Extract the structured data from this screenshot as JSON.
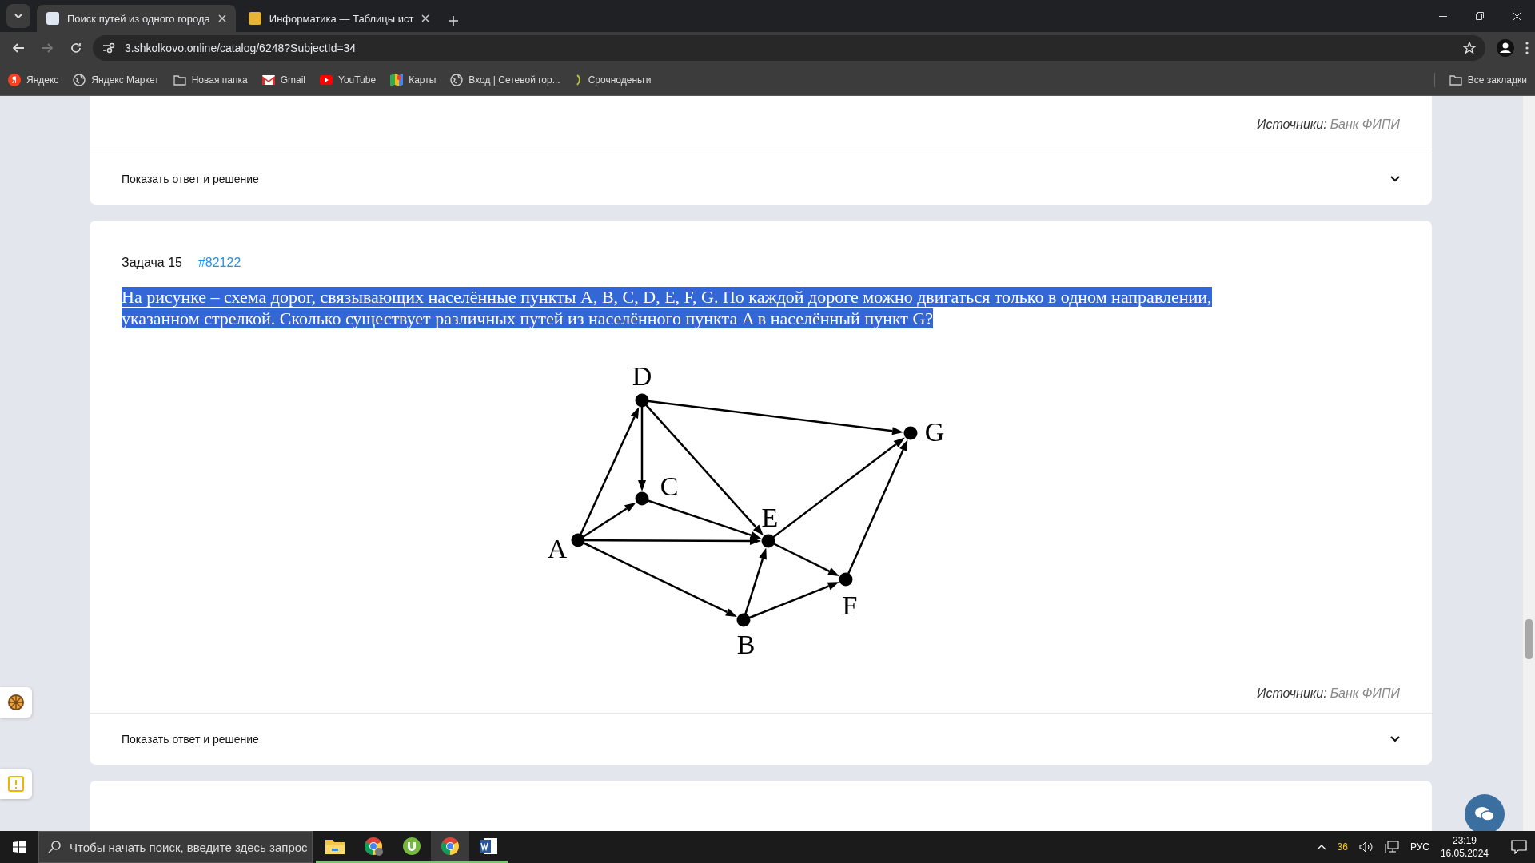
{
  "browser": {
    "tabs": [
      {
        "title": "Поиск путей из одного города",
        "selected": true
      },
      {
        "title": "Информатика — Таблицы ист",
        "selected": false
      }
    ],
    "address": "3.shkolkovo.online/catalog/6248?SubjectId=34",
    "bookmarks": [
      {
        "label": "Яндекс",
        "kind": "yandex"
      },
      {
        "label": "Яндекс Маркет",
        "kind": "globe"
      },
      {
        "label": "Новая папка",
        "kind": "folder"
      },
      {
        "label": "Gmail",
        "kind": "mail"
      },
      {
        "label": "YouTube",
        "kind": "video"
      },
      {
        "label": "Карты",
        "kind": "map"
      },
      {
        "label": "Вход | Сетевой гор...",
        "kind": "globe"
      },
      {
        "label": "Срочноденьги",
        "kind": "leaf"
      }
    ],
    "all_bookmarks": "Все закладки"
  },
  "page": {
    "prev_task": {
      "sources_label": "Источники:",
      "sources_value": "Банк ФИПИ",
      "show_answer": "Показать ответ и решение"
    },
    "task": {
      "title": "Задача 15",
      "number": "#82122",
      "statement": "На рисунке – схема дорог, связывающих населённые пункты A, B, C, D, E, F, G. По каждой дороге можно двигаться только в одном направлении, указанном стрелкой. Сколько существует различных путей из населённого пункта A в населённый пункт G?",
      "statement_highlighted": true,
      "graph_nodes": [
        "A",
        "B",
        "C",
        "D",
        "E",
        "F",
        "G"
      ],
      "sources_label": "Источники:",
      "sources_value": "Банк ФИПИ",
      "show_answer": "Показать ответ и решение"
    }
  },
  "taskbar": {
    "search_placeholder": "Чтобы начать поиск, введите здесь запрос",
    "apps": [
      {
        "kind": "explorer",
        "selected": false
      },
      {
        "kind": "chrome-gray",
        "selected": false
      },
      {
        "kind": "torrent",
        "selected": false
      },
      {
        "kind": "chrome",
        "selected": true
      },
      {
        "kind": "word",
        "selected": false
      }
    ],
    "tray_count": "36",
    "language": "РУС",
    "time": "23:19",
    "date": "16.05.2024"
  }
}
